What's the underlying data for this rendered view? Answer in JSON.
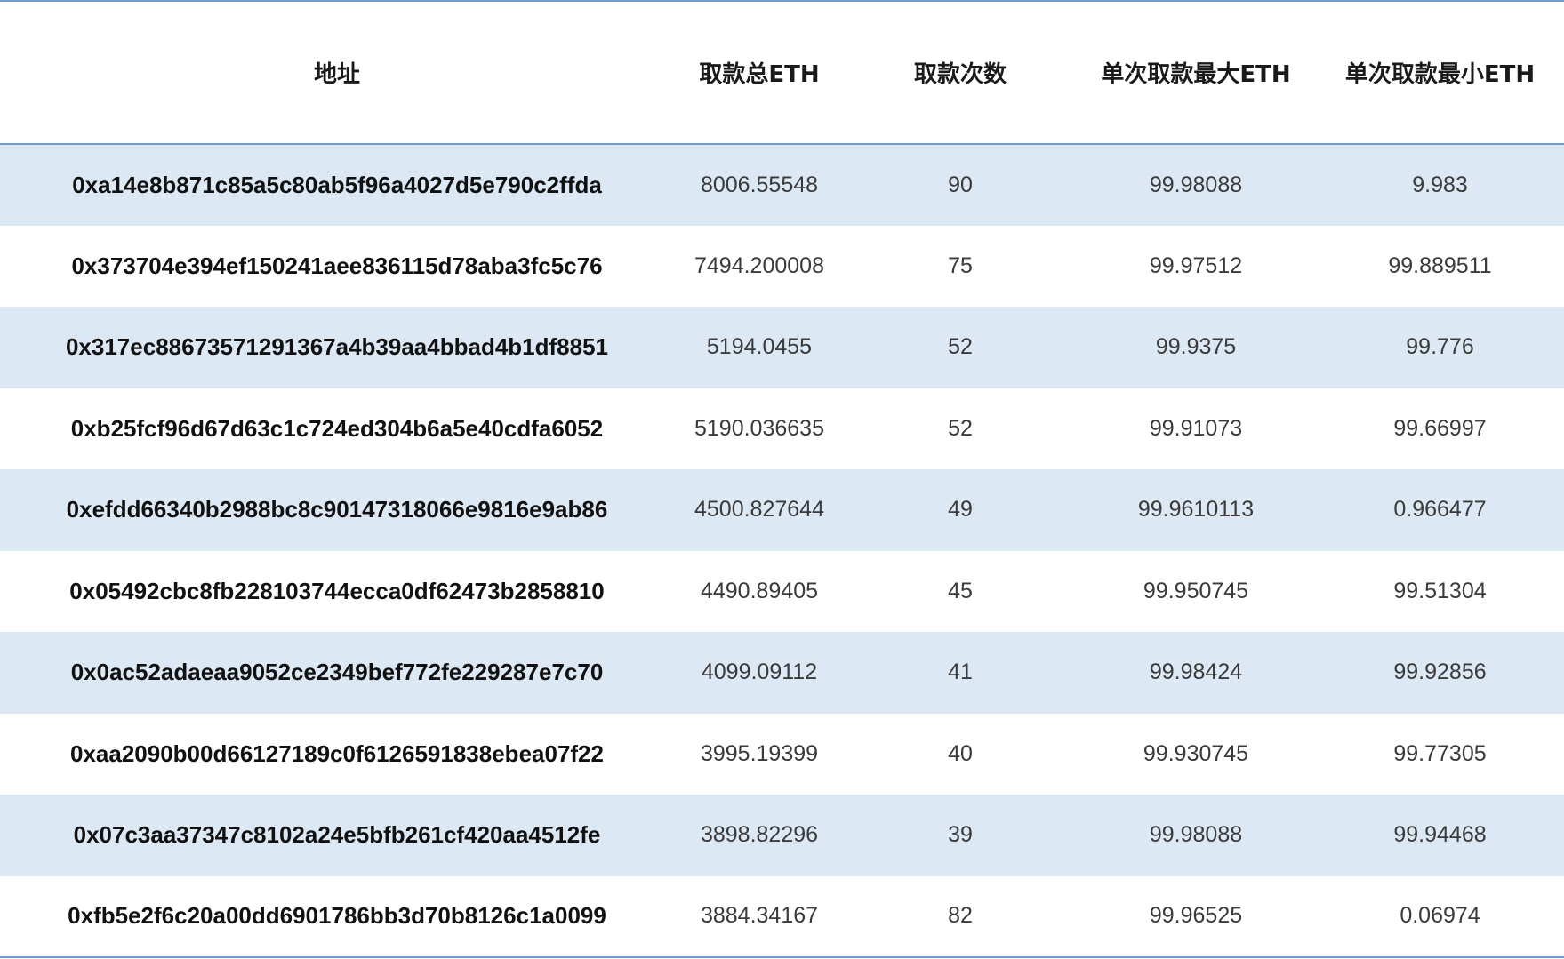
{
  "table": {
    "headers": [
      "地址",
      "取款总ETH",
      "取款次数",
      "单次取款最大ETH",
      "单次取款最小ETH"
    ],
    "rows": [
      [
        "0xa14e8b871c85a5c80ab5f96a4027d5e790c2ffda",
        "8006.55548",
        "90",
        "99.98088",
        "9.983"
      ],
      [
        "0x373704e394ef150241aee836115d78aba3fc5c76",
        "7494.200008",
        "75",
        "99.97512",
        "99.889511"
      ],
      [
        "0x317ec88673571291367a4b39aa4bbad4b1df8851",
        "5194.0455",
        "52",
        "99.9375",
        "99.776"
      ],
      [
        "0xb25fcf96d67d63c1c724ed304b6a5e40cdfa6052",
        "5190.036635",
        "52",
        "99.91073",
        "99.66997"
      ],
      [
        "0xefdd66340b2988bc8c90147318066e9816e9ab86",
        "4500.827644",
        "49",
        "99.9610113",
        "0.966477"
      ],
      [
        "0x05492cbc8fb228103744ecca0df62473b2858810",
        "4490.89405",
        "45",
        "99.950745",
        "99.51304"
      ],
      [
        "0x0ac52adaeaa9052ce2349bef772fe229287e7c70",
        "4099.09112",
        "41",
        "99.98424",
        "99.92856"
      ],
      [
        "0xaa2090b00d66127189c0f6126591838ebea07f22",
        "3995.19399",
        "40",
        "99.930745",
        "99.77305"
      ],
      [
        "0x07c3aa37347c8102a24e5bfb261cf420aa4512fe",
        "3898.82296",
        "39",
        "99.98088",
        "99.94468"
      ],
      [
        "0xfb5e2f6c20a00dd6901786bb3d70b8126c1a0099",
        "3884.34167",
        "82",
        "99.96525",
        "0.06974"
      ]
    ]
  },
  "colors": {
    "rule": "#6f9ccc",
    "row_shade": "#dde8f5",
    "background": "#ffffff"
  }
}
